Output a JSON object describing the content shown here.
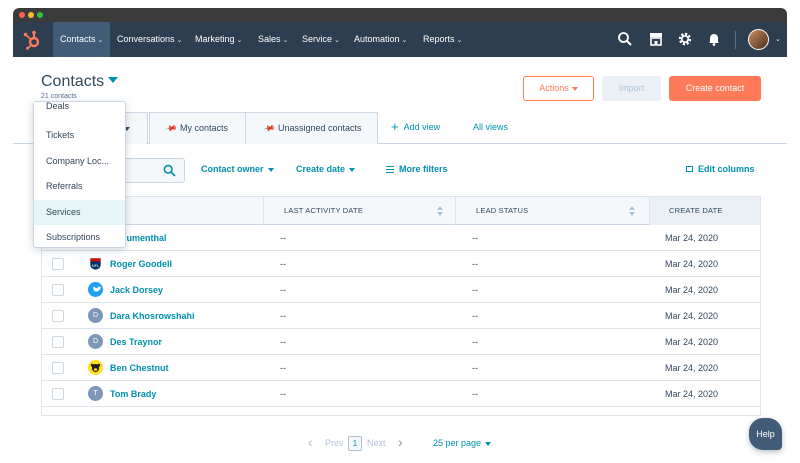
{
  "nav": {
    "items": [
      {
        "label": "Contacts"
      },
      {
        "label": "Conversations"
      },
      {
        "label": "Marketing"
      },
      {
        "label": "Sales"
      },
      {
        "label": "Service"
      },
      {
        "label": "Automation"
      },
      {
        "label": "Reports"
      }
    ],
    "icons": [
      "search-icon",
      "marketplace-icon",
      "settings-icon",
      "notifications-icon"
    ]
  },
  "header": {
    "title": "Contacts",
    "count": "21 contacts",
    "actions_label": "Actions",
    "import_label": "Import",
    "create_label": "Create contact"
  },
  "views": {
    "tabs": [
      {
        "label": ""
      },
      {
        "label": "My contacts"
      },
      {
        "label": "Unassigned contacts"
      }
    ],
    "add_view": "Add view",
    "all_views": "All views"
  },
  "filters": {
    "owner": "Contact owner",
    "create_date": "Create date",
    "more": "More filters",
    "edit_columns": "Edit columns"
  },
  "table": {
    "columns": [
      "LAST ACTIVITY DATE",
      "LEAD STATUS",
      "CREATE DATE"
    ],
    "rows": [
      {
        "name": "e Blumenthal",
        "activity": "--",
        "lead": "--",
        "date": "Mar 24, 2020",
        "avatar": "",
        "avatar_color": "#ffffff"
      },
      {
        "name": "Roger Goodell",
        "activity": "--",
        "lead": "--",
        "date": "Mar 24, 2020",
        "avatar": "nfl-logo-icon",
        "avatar_color": "#013369"
      },
      {
        "name": "Jack Dorsey",
        "activity": "--",
        "lead": "--",
        "date": "Mar 24, 2020",
        "avatar": "twitter-icon",
        "avatar_color": "#1da1f2"
      },
      {
        "name": "Dara Khosrowshahi",
        "activity": "--",
        "lead": "--",
        "date": "Mar 24, 2020",
        "avatar": "D",
        "avatar_color": "#7c98b6"
      },
      {
        "name": "Des Traynor",
        "activity": "--",
        "lead": "--",
        "date": "Mar 24, 2020",
        "avatar": "D",
        "avatar_color": "#7c98b6"
      },
      {
        "name": "Ben Chestnut",
        "activity": "--",
        "lead": "--",
        "date": "Mar 24, 2020",
        "avatar": "mailchimp-icon",
        "avatar_color": "#ffe01b"
      },
      {
        "name": "Tom Brady",
        "activity": "--",
        "lead": "--",
        "date": "Mar 24, 2020",
        "avatar": "T",
        "avatar_color": "#7c98b6"
      }
    ]
  },
  "pager": {
    "prev": "Prev",
    "page": "1",
    "next": "Next",
    "per_page": "25 per page"
  },
  "help_label": "Help",
  "dropdown": {
    "items": [
      "Deals",
      "Tickets",
      "Company Loc...",
      "Referrals",
      "Services",
      "Subscriptions"
    ],
    "hovered": "Services"
  },
  "colors": {
    "nav_bg": "#2d3e50",
    "accent": "#ff7a59",
    "link": "#0091ae"
  }
}
